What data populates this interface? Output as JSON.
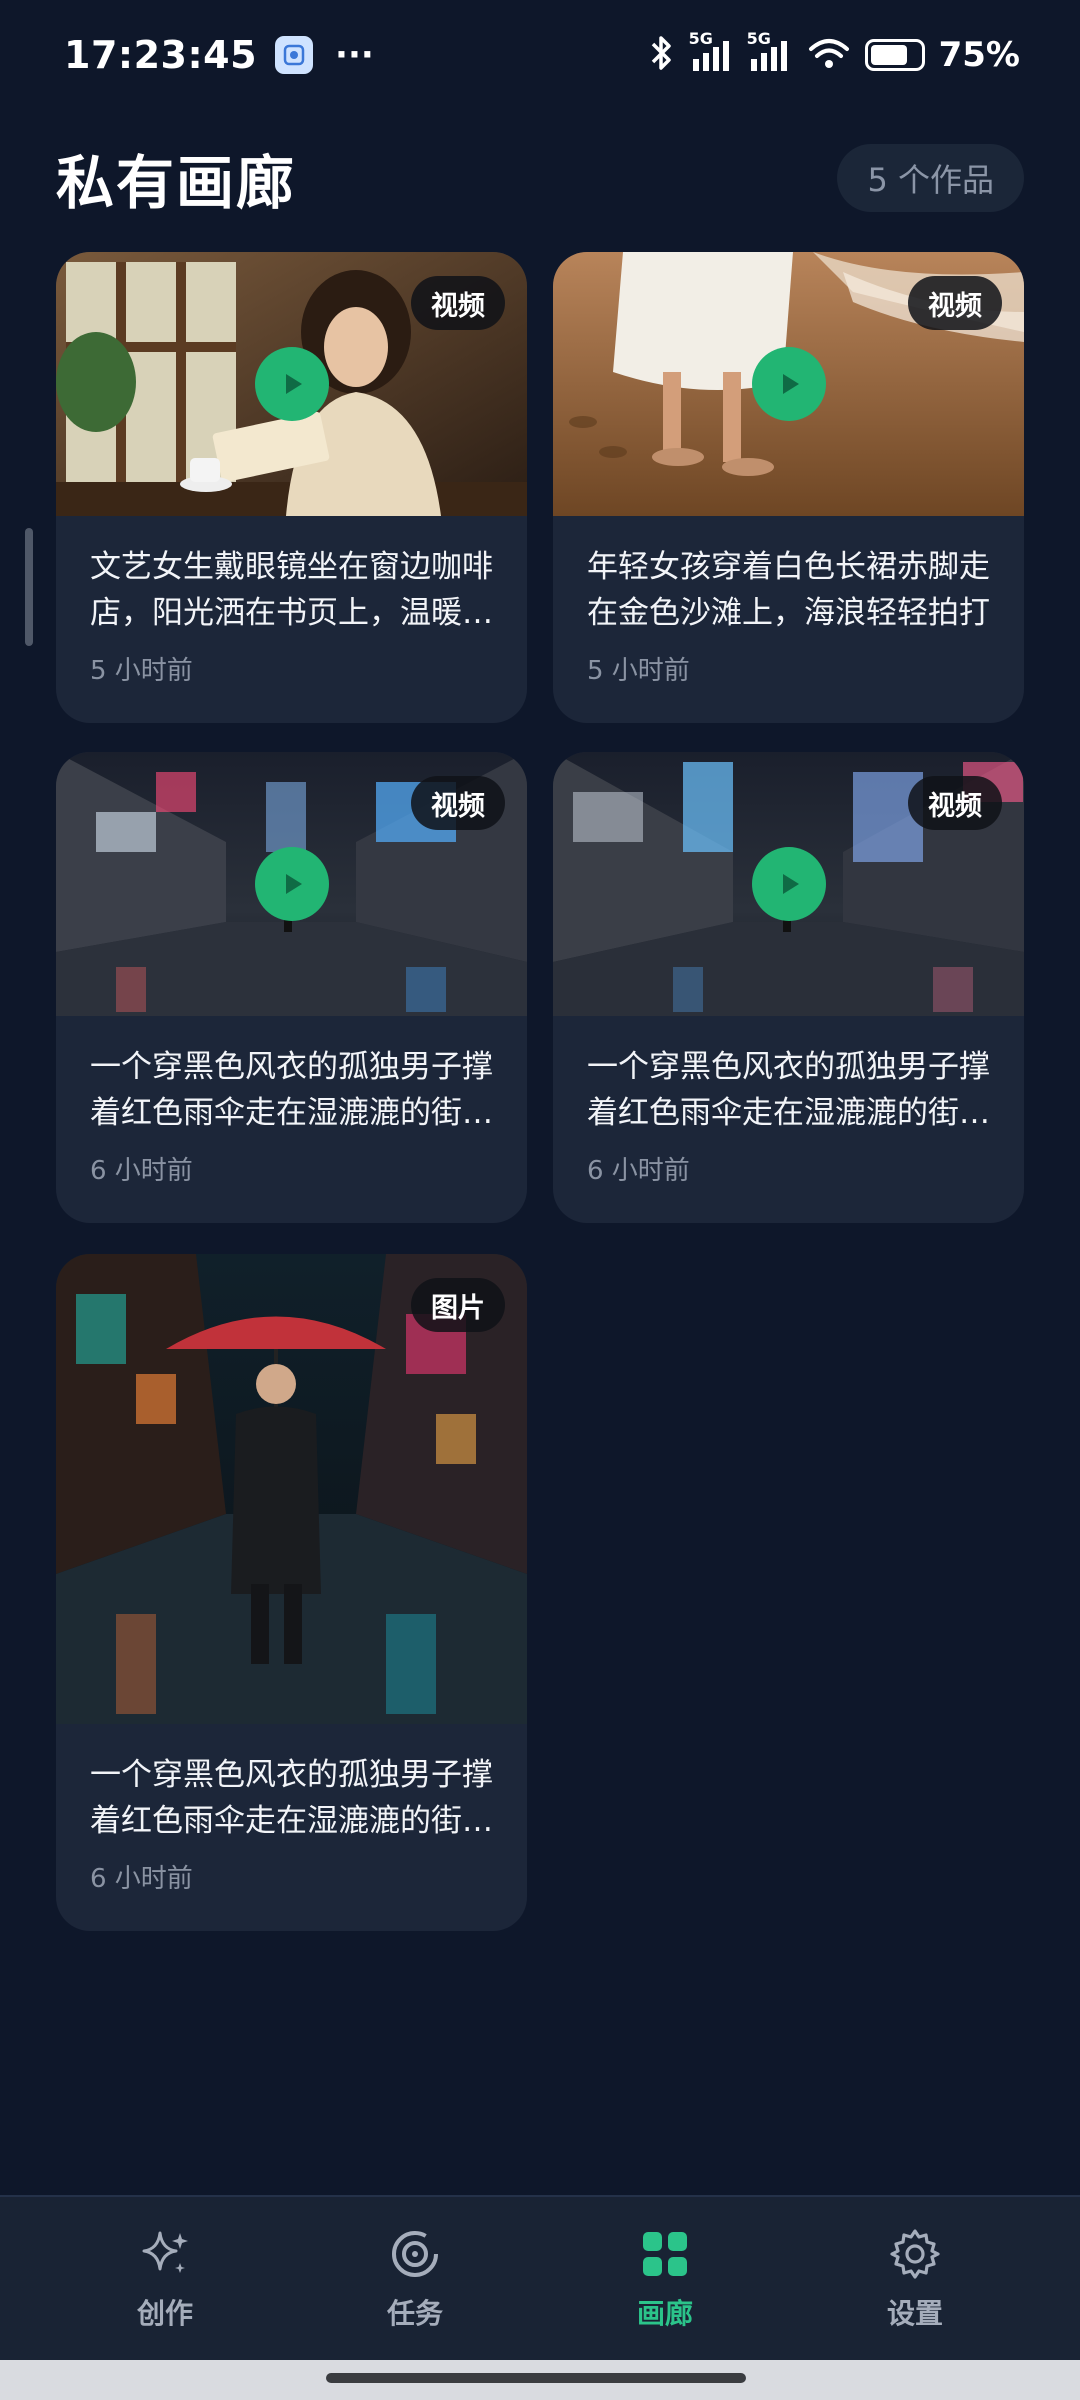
{
  "status_bar": {
    "time": "17:23:45",
    "dots": "···",
    "battery_text": "75%",
    "battery_level": 0.75,
    "network_1": "5G",
    "network_2": "5G"
  },
  "header": {
    "title": "私有画廊",
    "count": "5 个作品"
  },
  "gallery": {
    "items": [
      {
        "type": "视频",
        "title": "文艺女生戴眼镜坐在窗边咖啡店，阳光洒在书页上，温暖的氛围",
        "time": "5 小时前",
        "has_play": true
      },
      {
        "type": "视频",
        "title": "年轻女孩穿着白色长裙赤脚走在金色沙滩上，海浪轻轻拍打",
        "time": "5 小时前",
        "has_play": true
      },
      {
        "type": "视频",
        "title": "一个穿黑色风衣的孤独男子撑着红色雨伞走在湿漉漉的街道上",
        "time": "6 小时前",
        "has_play": true
      },
      {
        "type": "视频",
        "title": "一个穿黑色风衣的孤独男子撑着红色雨伞走在湿漉漉的街道上",
        "time": "6 小时前",
        "has_play": true
      },
      {
        "type": "图片",
        "title": "一个穿黑色风衣的孤独男子撑着红色雨伞走在湿漉漉的街道上",
        "time": "6 小时前",
        "has_play": false
      }
    ]
  },
  "nav": {
    "items": [
      {
        "label": "创作",
        "icon": "sparkle-icon"
      },
      {
        "label": "任务",
        "icon": "target-icon"
      },
      {
        "label": "画廊",
        "icon": "grid-icon",
        "active": true
      },
      {
        "label": "设置",
        "icon": "gear-icon"
      }
    ]
  },
  "colors": {
    "background": "#0e172a",
    "card": "#1c2639",
    "accent": "#22b573",
    "nav_active": "#2bc48a"
  }
}
